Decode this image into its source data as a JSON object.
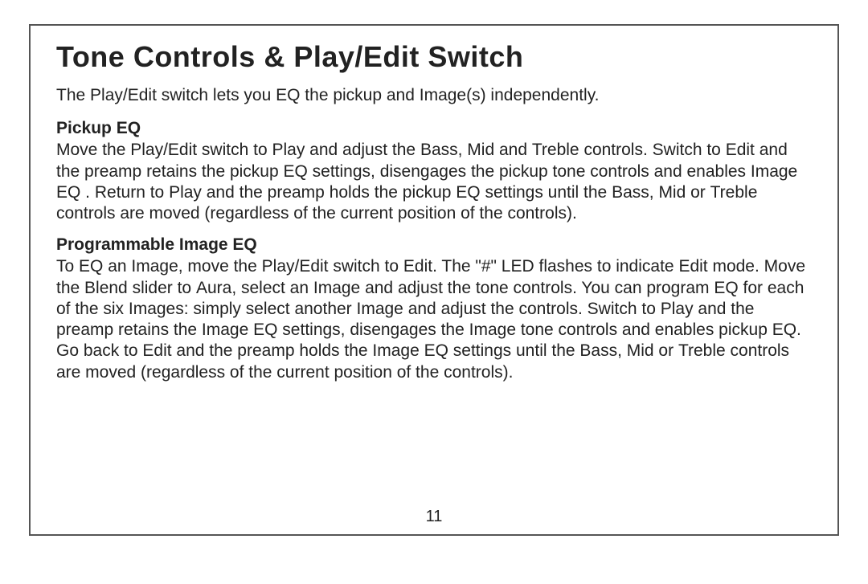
{
  "title": "Tone Controls & Play/Edit Switch",
  "intro_pre": "The ",
  "intro_sw": "Play/Edit",
  "intro_post": " switch lets you EQ the pickup and Image(s) independently.",
  "section1": {
    "heading": "Pickup EQ",
    "t1": "Move the ",
    "sw": "Play/Edit",
    "t2": " switch to ",
    "play": "Play",
    "t3": " and adjust the ",
    "bass": "Bass",
    "t4": ", ",
    "mid": "Mid",
    "t5": " and ",
    "treble": "Treble",
    "t6": " controls. Switch to ",
    "edit": "Edit",
    "t7": " and the preamp retains the pickup EQ settings, disengages the pickup tone controls and enables Image EQ . Return to ",
    "play2": "Play",
    "t8": " and the preamp holds the pickup EQ settings until the ",
    "bass2": "Bass",
    "t9": ", ",
    "mid2": "Mid",
    "t10": " or ",
    "treble2": "Treble",
    "t11": " controls are moved (regardless of the current position of the controls)."
  },
  "section2": {
    "heading": "Programmable Image EQ",
    "t1": "To EQ an Image, move the ",
    "sw": "Play/Edit",
    "t2": " switch to ",
    "edit": "Edit",
    "t3": ". The \"#\" LED flashes to indicate ",
    "edit2": "Edit",
    "t4": " mode. Move the ",
    "blend": "Blend",
    "t5": " slider to ",
    "aura": "Aura",
    "t6": ", select an Image and adjust the tone controls. You can program EQ for each of the six Images: simply select another Image and adjust the controls. Switch to ",
    "play": "Play",
    "t7": " and the preamp retains the Image EQ settings, disengages the Image tone controls and enables pickup EQ. Go back to ",
    "edit3": "Edit",
    "t8": " and the preamp holds the Image EQ settings until the ",
    "bass": "Bass",
    "t9": ", ",
    "mid": "Mid",
    "t10": " or ",
    "treble": "Treble",
    "t11": " controls are moved (regardless of the current position of the controls)."
  },
  "page_number": "11"
}
